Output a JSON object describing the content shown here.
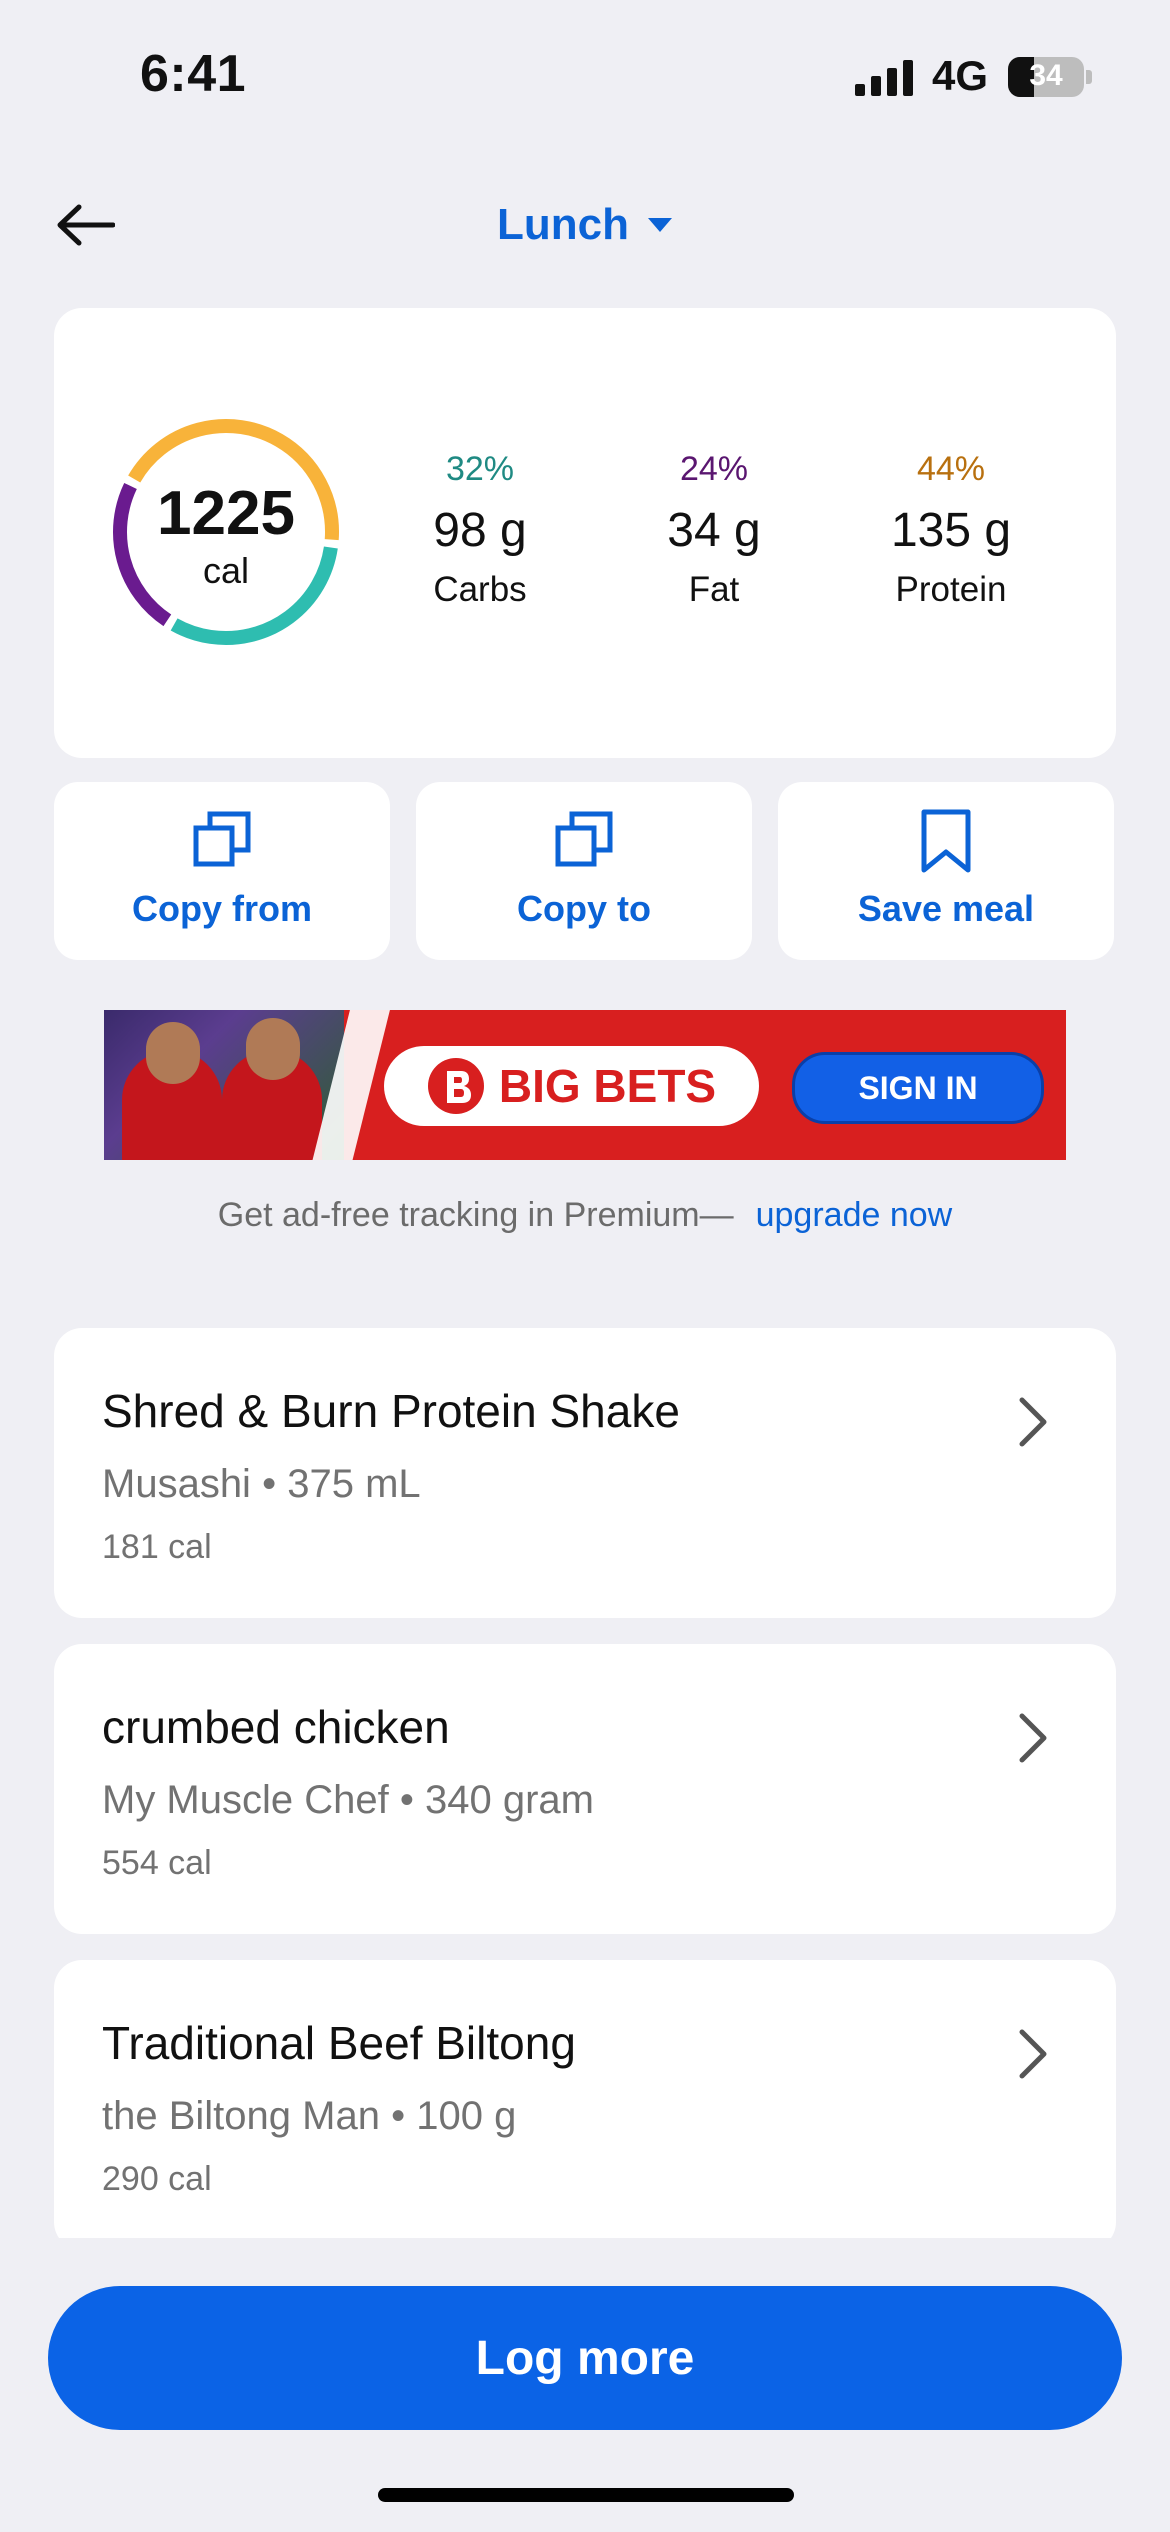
{
  "status_bar": {
    "time": "6:41",
    "network": "4G",
    "battery": "34"
  },
  "header": {
    "title": "Lunch"
  },
  "summary": {
    "calories": "1225",
    "calories_unit": "cal",
    "macros": [
      {
        "percent": "32%",
        "grams": "98 g",
        "label": "Carbs",
        "color": "#1f8a83"
      },
      {
        "percent": "24%",
        "grams": "34 g",
        "label": "Fat",
        "color": "#5a1670"
      },
      {
        "percent": "44%",
        "grams": "135 g",
        "label": "Protein",
        "color": "#b8700f"
      }
    ],
    "ring_colors": {
      "carbs": "#2ebdb0",
      "fat": "#6a1b8f",
      "protein": "#f8b33a"
    }
  },
  "actions": [
    {
      "label": "Copy from",
      "icon": "copy-icon"
    },
    {
      "label": "Copy to",
      "icon": "copy-icon"
    },
    {
      "label": "Save meal",
      "icon": "bookmark-icon"
    }
  ],
  "ad": {
    "brand": "BIG BETS",
    "cta": "SIGN IN"
  },
  "promo": {
    "text": "Get ad-free tracking in Premium—",
    "link": "upgrade now"
  },
  "foods": [
    {
      "name": "Shred & Burn Protein Shake",
      "brand": "Musashi",
      "serving": "375 mL",
      "calories": "181 cal"
    },
    {
      "name": "crumbed chicken",
      "brand": "My Muscle Chef",
      "serving": "340 gram",
      "calories": "554 cal"
    },
    {
      "name": "Traditional Beef Biltong",
      "brand": "the Biltong Man",
      "serving": "100 g",
      "calories": "290 cal"
    }
  ],
  "separator": "•",
  "log_more": "Log more",
  "colors": {
    "accent": "#0b63d6",
    "background": "#efeff4"
  }
}
